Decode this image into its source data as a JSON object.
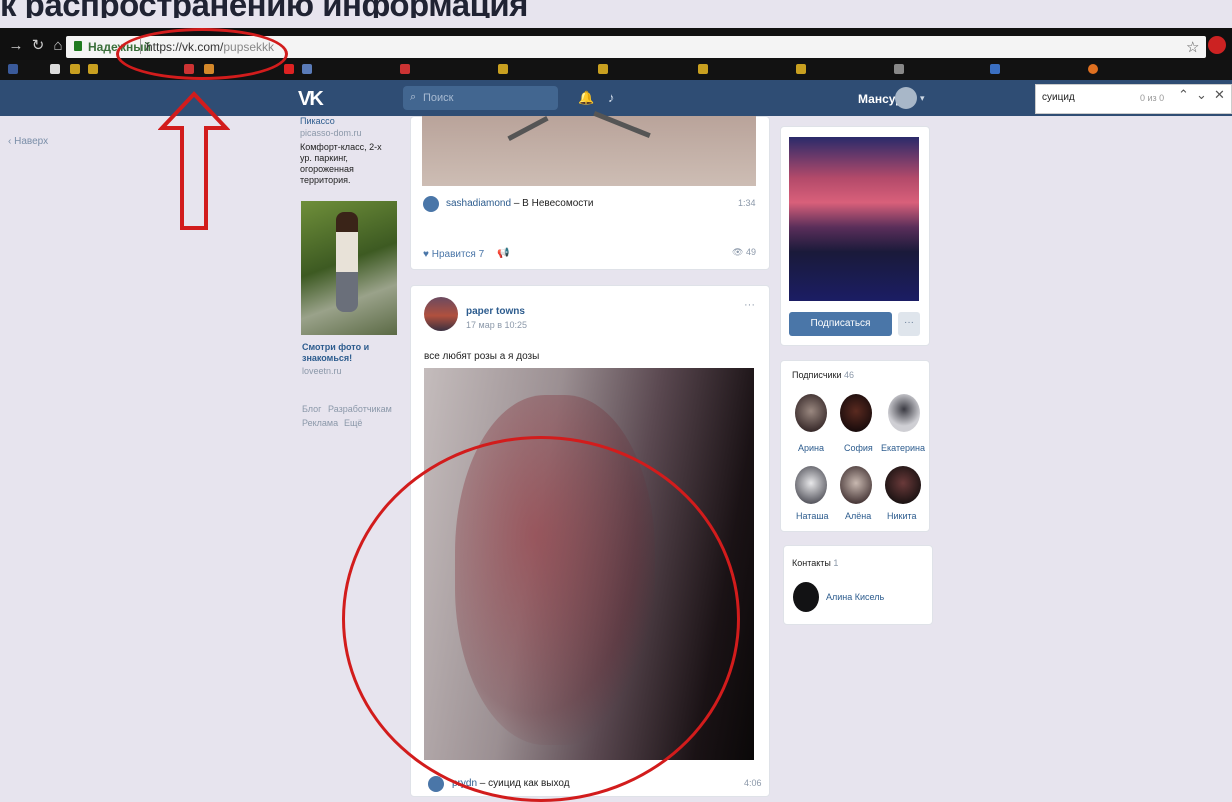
{
  "slide": {
    "title": "к распространению информация"
  },
  "browser": {
    "secure_label": "Надежный",
    "url": "https://vk.com/pupsekkk",
    "url_host": "https://vk.com/",
    "url_path": "pupsekkk",
    "find": {
      "query": "суицид",
      "count": "0 из 0"
    }
  },
  "vk": {
    "logo": "VK",
    "search_placeholder": "Поиск",
    "user_name": "Мансур",
    "left_nav": "Наверх"
  },
  "ads": {
    "ad1": {
      "title": "Пикассо",
      "domain": "picasso-dom.ru",
      "text": "Комфорт-класс, 2-х ур. паркинг, огороженная территория."
    },
    "ad2": {
      "title": "Смотри фото и знакомься!",
      "domain": "loveetn.ru"
    },
    "footer": {
      "blog": "Блог",
      "dev": "Разработчикам",
      "ads": "Реклама",
      "more": "Ещё"
    }
  },
  "post1": {
    "audio_artist": "sashadiamond",
    "audio_sep": "–",
    "audio_title": "В Невесомости",
    "audio_duration": "1:34",
    "likes_label": "Нравится",
    "likes_count": "7",
    "views": "49"
  },
  "post2": {
    "author": "paper towns",
    "date": "17 мар в 10:25",
    "text": "все любят розы а я дозы",
    "audio_artist": "prydn",
    "audio_sep": "–",
    "audio_title": "суицид как выход",
    "audio_duration": "4:06"
  },
  "profile": {
    "subscribe_label": "Подписаться",
    "more_label": "···",
    "followers_title": "Подписчики",
    "followers_count": "46",
    "followers": [
      "Арина",
      "София",
      "Екатерина",
      "Наташа",
      "Алёна",
      "Никита"
    ],
    "contacts_title": "Контакты",
    "contacts_count": "1",
    "contact_name": "Алина Кисель"
  },
  "colors": {
    "vk_header": "#2f4d74",
    "annotation_red": "#d21c1c",
    "vk_button": "#4a76a8"
  }
}
